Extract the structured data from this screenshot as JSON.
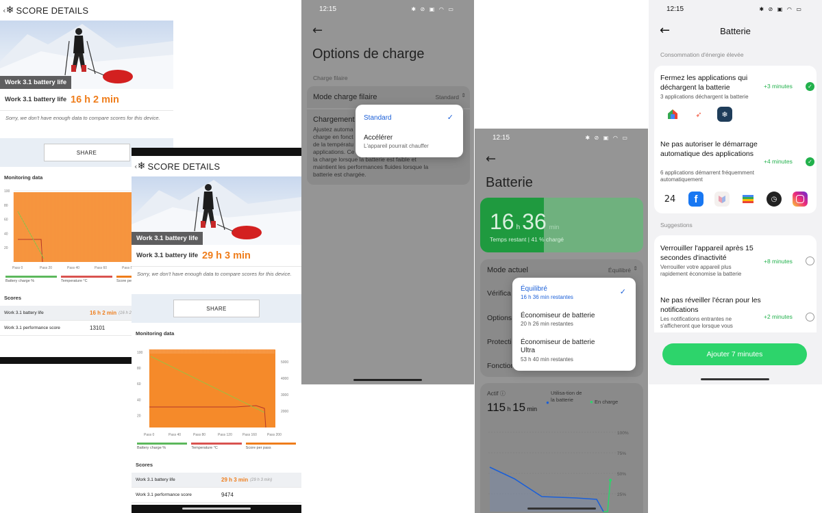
{
  "score_a": {
    "header": "SCORE DETAILS",
    "hero_caption": "Work 3.1 battery life",
    "result_label": "Work 3.1 battery life",
    "result_value": "16 h 2 min",
    "sorry": "Sorry, we don't have enough data to compare scores for this device.",
    "share": "SHARE",
    "monitoring": "Monitoring data",
    "y_ticks": [
      "100",
      "80",
      "60",
      "40",
      "20"
    ],
    "x_ticks": [
      "Pass 0",
      "Pass 20",
      "Pass 40",
      "Pass 60",
      "Pass 80",
      "Pass"
    ],
    "legend": [
      "Battery charge %",
      "Temperature °C",
      "Score per pas"
    ],
    "scores_title": "Scores",
    "score_rows": [
      {
        "name": "Work 3.1 battery life",
        "value": "16 h 2 min",
        "sub": "(16 h 2"
      },
      {
        "name": "Work 3.1 performance score",
        "value": "13101",
        "sub": ""
      }
    ]
  },
  "score_b": {
    "header": "SCORE DETAILS",
    "hero_caption": "Work 3.1 battery life",
    "result_label": "Work 3.1 battery life",
    "result_value": "29 h 3 min",
    "sorry": "Sorry, we don't have enough data to compare scores for this device.",
    "share": "SHARE",
    "monitoring": "Monitoring data",
    "y_ticks": [
      "100",
      "80",
      "60",
      "40",
      "20"
    ],
    "y2_ticks": [
      "5000",
      "4000",
      "3000",
      "2000"
    ],
    "x_ticks": [
      "Pass 0",
      "Pass 40",
      "Pass 80",
      "Pass 120",
      "Pass 160",
      "Pass 200"
    ],
    "legend": [
      "Battery charge %",
      "Temperature °C",
      "Score per pass"
    ],
    "scores_title": "Scores",
    "score_rows": [
      {
        "name": "Work 3.1 battery life",
        "value": "29 h 3 min",
        "sub": "(29 h 3 min)"
      },
      {
        "name": "Work 3.1 performance score",
        "value": "9474",
        "sub": ""
      }
    ]
  },
  "charge": {
    "time": "12:15",
    "title": "Options de charge",
    "section": "Charge filaire",
    "mode_label": "Mode charge filaire",
    "mode_value": "Standard",
    "charging_title": "Chargement",
    "charging_desc": "Ajustez automa... charge en fonct... de la températu... applications. Ce... la charge lorsque la batterie est faible et maintient les performances fluides lorsque la batterie est chargée.",
    "desc_lines": [
      "Ajustez automa",
      "charge en fonct",
      "de la températu",
      "applications. Ce",
      "la charge lorsque la batterie est faible et",
      "maintient les performances fluides lorsque la",
      "batterie est chargée."
    ],
    "popup": [
      {
        "label": "Standard",
        "sub": "",
        "selected": true
      },
      {
        "label": "Accélérer",
        "sub": "L'appareil pourrait chauffer",
        "selected": false
      }
    ]
  },
  "battery": {
    "time": "12:15",
    "title": "Batterie",
    "hours": "16",
    "hours_unit": "h",
    "minutes": "36",
    "minutes_unit": "min",
    "remaining": "Temps restant | 41 % chargé",
    "charge_level_percent": 41,
    "mode_label": "Mode actuel",
    "mode_value": "Équilibré",
    "hidden_rows": [
      "Vérifica",
      "Options",
      "Protecti",
      "Fonction"
    ],
    "popup": [
      {
        "label": "Équilibré",
        "sub": "16 h 36 min restantes",
        "selected": true
      },
      {
        "label": "Économiseur de batterie",
        "sub": "20 h 26 min restantes",
        "selected": false
      },
      {
        "label": "Économiseur de batterie Ultra",
        "sub": "53 h 40 min restantes",
        "selected": false
      }
    ],
    "active_label": "Actif",
    "active_hours": "115",
    "active_minutes": "15",
    "legend_usage": "Utilisa-tion de la batterie",
    "legend_charge": "En charge",
    "y_ticks": [
      "100%",
      "75%",
      "50%",
      "25%"
    ]
  },
  "battery2": {
    "time": "12:15",
    "title": "Batterie",
    "section_high": "Consommation d'énergie élevée",
    "items": [
      {
        "title": "Fermez les applications qui déchargent la batterie",
        "desc": "3 applications déchargent la batterie",
        "gain": "+3 minutes",
        "checked": true
      },
      {
        "title": "Ne pas autoriser le démarrage automatique des applications",
        "desc": "6 applications démarrent fréquemment automatiquement",
        "gain": "+4 minutes",
        "checked": true
      }
    ],
    "section_sugg": "Suggestions",
    "suggestions": [
      {
        "title": "Verrouiller l'appareil après 15 secondes d'inactivité",
        "desc": "Verrouiller votre appareil plus rapidement économise la batterie",
        "gain": "+8 minutes",
        "checked": false
      },
      {
        "title": "Ne pas réveiller l'écran pour les notifications",
        "desc": "Les notifications entrantes ne s'afficheront que lorsque vous",
        "gain": "+2 minutes",
        "checked": false
      }
    ],
    "app_24": "24",
    "button": "Ajouter 7 minutes"
  },
  "colors": {
    "orange": "#ef7d1b",
    "green": "#2dd46b",
    "blue": "#1a5fd8",
    "check_green": "#22b14c"
  }
}
